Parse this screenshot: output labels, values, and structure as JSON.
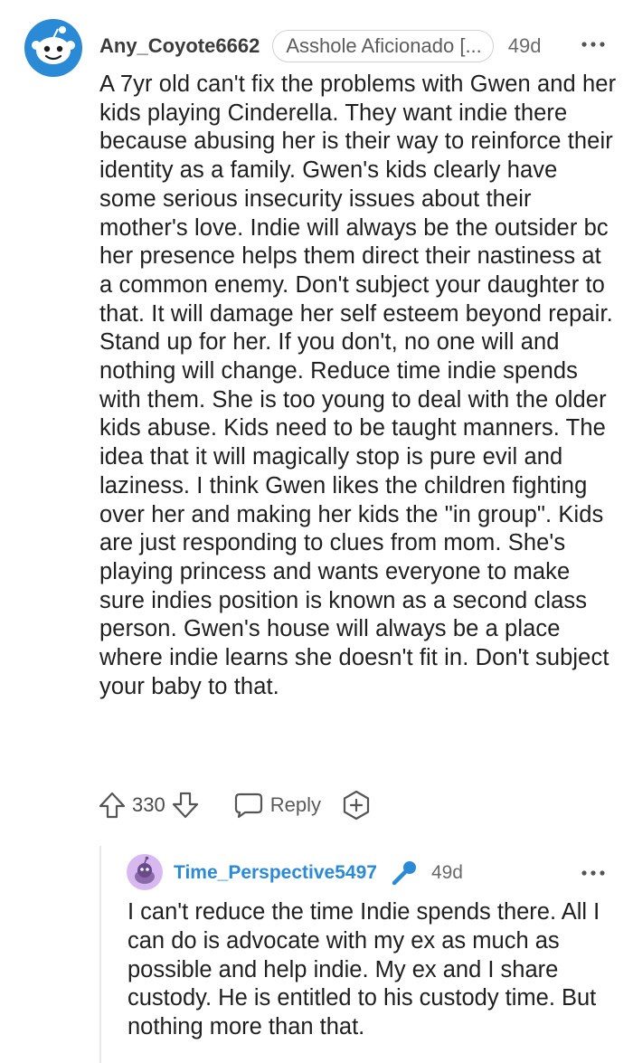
{
  "comment": {
    "avatar_icon": "snoo-avatar-icon",
    "username": "Any_Coyote6662",
    "flair": "Asshole Aficionado [...",
    "age": "49d",
    "more_icon": "more-options-icon",
    "body": "A 7yr old can't fix the problems with Gwen and her kids playing Cinderella. They want indie there because abusing her is their way to reinforce their identity as a family. Gwen's kids clearly have some serious insecurity issues about their mother's love. Indie will always be the outsider bc her presence helps them direct their nastiness at a common enemy. Don't subject your daughter to that. It will damage her self esteem beyond repair. Stand up for her. If you don't, no one will and nothing will change. Reduce time indie spends with them. She is too young to deal with the older kids abuse. Kids need to be taught manners. The idea that it will magically stop is pure evil and laziness. I think Gwen likes the children fighting over her and making her kids the \"in group\". Kids are just responding to clues from mom. She's playing princess and wants everyone to make sure indies position is known as a second class person. Gwen's house will always be a place where indie learns she doesn't fit in. Don't subject your baby to that.",
    "actions": {
      "score": "330",
      "reply_label": "Reply"
    }
  },
  "reply": {
    "username": "Time_Perspective5497",
    "age": "49d",
    "body": "I can't reduce the time Indie spends there. All I can do is advocate with my ex as much as possible and help indie. My ex and I share custody. He is entitled to his custody time. But nothing more than that."
  },
  "colors": {
    "text": "#1f1f1f",
    "username_reply": "#2a8ad6",
    "avatar_blue": "#2a8ad6",
    "reply_avatar_bg": "#d8b8f0",
    "mic_blue": "#2a8ad6",
    "flair_border": "#cfd3d6"
  }
}
